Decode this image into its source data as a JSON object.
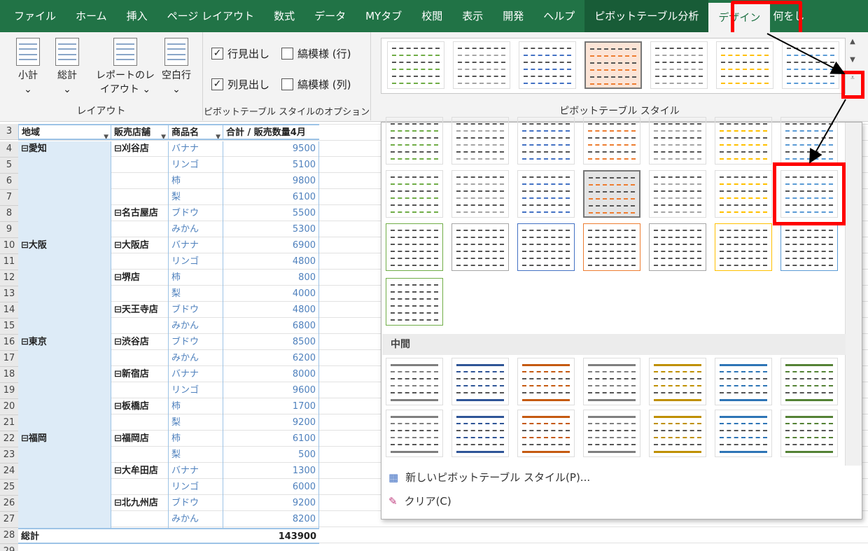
{
  "tabs": [
    "ファイル",
    "ホーム",
    "挿入",
    "ページ レイアウト",
    "数式",
    "データ",
    "MYタブ",
    "校閲",
    "表示",
    "開発",
    "ヘルプ",
    "ピボットテーブル分析",
    "デザイン",
    "何をし"
  ],
  "ribbon": {
    "layout_buttons": [
      {
        "label": "小計",
        "sub": "⌄"
      },
      {
        "label": "総計",
        "sub": "⌄"
      },
      {
        "label": "レポートのレ",
        "label2": "イアウト ⌄"
      },
      {
        "label": "空白行",
        "sub": "⌄"
      }
    ],
    "layout_group": "レイアウト",
    "opt_row_headers": "行見出し",
    "opt_col_headers": "列見出し",
    "opt_banded_rows": "縞模様 (行)",
    "opt_banded_cols": "縞模様 (列)",
    "options_group": "ピボットテーブル スタイルのオプション",
    "styles_group": "ピボットテーブル スタイル"
  },
  "headers": {
    "region": "地域",
    "store": "販売店舗",
    "product": "商品名",
    "total": "合計 / 販売数量4月"
  },
  "rows": [
    {
      "n": "4",
      "region": "⊟愛知",
      "store": "⊟刈谷店",
      "product": "バナナ",
      "v": "9500"
    },
    {
      "n": "5",
      "region": "",
      "store": "",
      "product": "リンゴ",
      "v": "5100"
    },
    {
      "n": "6",
      "region": "",
      "store": "",
      "product": "柿",
      "v": "9800"
    },
    {
      "n": "7",
      "region": "",
      "store": "",
      "product": "梨",
      "v": "6100"
    },
    {
      "n": "8",
      "region": "",
      "store": "⊟名古屋店",
      "product": "ブドウ",
      "v": "5500"
    },
    {
      "n": "9",
      "region": "",
      "store": "",
      "product": "みかん",
      "v": "5300"
    },
    {
      "n": "10",
      "region": "⊟大阪",
      "store": "⊟大阪店",
      "product": "バナナ",
      "v": "6900"
    },
    {
      "n": "11",
      "region": "",
      "store": "",
      "product": "リンゴ",
      "v": "4800"
    },
    {
      "n": "12",
      "region": "",
      "store": "⊟堺店",
      "product": "柿",
      "v": "800"
    },
    {
      "n": "13",
      "region": "",
      "store": "",
      "product": "梨",
      "v": "4000"
    },
    {
      "n": "14",
      "region": "",
      "store": "⊟天王寺店",
      "product": "ブドウ",
      "v": "4800"
    },
    {
      "n": "15",
      "region": "",
      "store": "",
      "product": "みかん",
      "v": "6800"
    },
    {
      "n": "16",
      "region": "⊟東京",
      "store": "⊟渋谷店",
      "product": "ブドウ",
      "v": "8500"
    },
    {
      "n": "17",
      "region": "",
      "store": "",
      "product": "みかん",
      "v": "6200"
    },
    {
      "n": "18",
      "region": "",
      "store": "⊟新宿店",
      "product": "バナナ",
      "v": "8000"
    },
    {
      "n": "19",
      "region": "",
      "store": "",
      "product": "リンゴ",
      "v": "9600"
    },
    {
      "n": "20",
      "region": "",
      "store": "⊟板橋店",
      "product": "柿",
      "v": "1700"
    },
    {
      "n": "21",
      "region": "",
      "store": "",
      "product": "梨",
      "v": "9200"
    },
    {
      "n": "22",
      "region": "⊟福岡",
      "store": "⊟福岡店",
      "product": "柿",
      "v": "6100"
    },
    {
      "n": "23",
      "region": "",
      "store": "",
      "product": "梨",
      "v": "500"
    },
    {
      "n": "24",
      "region": "",
      "store": "⊟大牟田店",
      "product": "バナナ",
      "v": "1300"
    },
    {
      "n": "25",
      "region": "",
      "store": "",
      "product": "リンゴ",
      "v": "6000"
    },
    {
      "n": "26",
      "region": "",
      "store": "⊟北九州店",
      "product": "ブドウ",
      "v": "9200"
    },
    {
      "n": "27",
      "region": "",
      "store": "",
      "product": "みかん",
      "v": "8200"
    }
  ],
  "header_row_num": "3",
  "grand_total": {
    "n": "28",
    "label": "総計",
    "v": "143900"
  },
  "last_row_num": "29",
  "gallery": {
    "light_colors": [
      "#70ad47",
      "#a5a5a5",
      "#4472c4",
      "#ed7d31",
      "#a5a5a5",
      "#ffc000",
      "#5b9bd5"
    ],
    "medium_label": "中間",
    "medium_colors": [
      "#7f7f7f",
      "#2f5597",
      "#c55a11",
      "#7f7f7f",
      "#bf9000",
      "#2e75b6",
      "#548235"
    ],
    "new_style": "新しいピボットテーブル スタイル(P)...",
    "clear": "クリア(C)"
  }
}
